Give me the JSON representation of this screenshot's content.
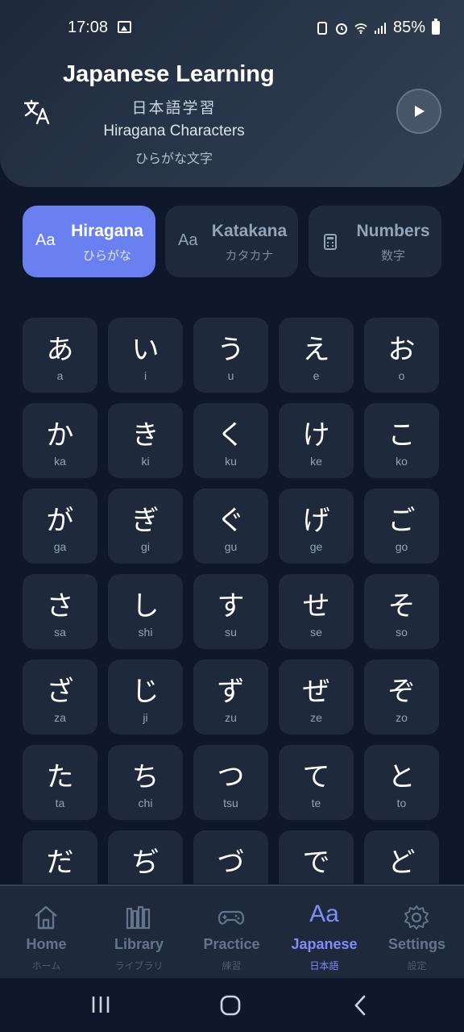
{
  "status": {
    "time": "17:08",
    "battery": "85%"
  },
  "header": {
    "title": "Japanese Learning",
    "subtitle_jp": "日本語学習",
    "subtitle": "Hiragana Characters",
    "subtitle_kana": "ひらがな文字"
  },
  "tabs": [
    {
      "icon": "Aa",
      "title": "Hiragana",
      "sub": "ひらがな",
      "active": true
    },
    {
      "icon": "Aa",
      "title": "Katakana",
      "sub": "カタカナ",
      "active": false
    },
    {
      "icon": "calculator-icon",
      "title": "Numbers",
      "sub": "数字",
      "active": false
    }
  ],
  "characters": [
    {
      "kana": "あ",
      "romaji": "a"
    },
    {
      "kana": "い",
      "romaji": "i"
    },
    {
      "kana": "う",
      "romaji": "u"
    },
    {
      "kana": "え",
      "romaji": "e"
    },
    {
      "kana": "お",
      "romaji": "o"
    },
    {
      "kana": "か",
      "romaji": "ka"
    },
    {
      "kana": "き",
      "romaji": "ki"
    },
    {
      "kana": "く",
      "romaji": "ku"
    },
    {
      "kana": "け",
      "romaji": "ke"
    },
    {
      "kana": "こ",
      "romaji": "ko"
    },
    {
      "kana": "が",
      "romaji": "ga"
    },
    {
      "kana": "ぎ",
      "romaji": "gi"
    },
    {
      "kana": "ぐ",
      "romaji": "gu"
    },
    {
      "kana": "げ",
      "romaji": "ge"
    },
    {
      "kana": "ご",
      "romaji": "go"
    },
    {
      "kana": "さ",
      "romaji": "sa"
    },
    {
      "kana": "し",
      "romaji": "shi"
    },
    {
      "kana": "す",
      "romaji": "su"
    },
    {
      "kana": "せ",
      "romaji": "se"
    },
    {
      "kana": "そ",
      "romaji": "so"
    },
    {
      "kana": "ざ",
      "romaji": "za"
    },
    {
      "kana": "じ",
      "romaji": "ji"
    },
    {
      "kana": "ず",
      "romaji": "zu"
    },
    {
      "kana": "ぜ",
      "romaji": "ze"
    },
    {
      "kana": "ぞ",
      "romaji": "zo"
    },
    {
      "kana": "た",
      "romaji": "ta"
    },
    {
      "kana": "ち",
      "romaji": "chi"
    },
    {
      "kana": "つ",
      "romaji": "tsu"
    },
    {
      "kana": "て",
      "romaji": "te"
    },
    {
      "kana": "と",
      "romaji": "to"
    },
    {
      "kana": "だ",
      "romaji": ""
    },
    {
      "kana": "ぢ",
      "romaji": ""
    },
    {
      "kana": "づ",
      "romaji": ""
    },
    {
      "kana": "で",
      "romaji": ""
    },
    {
      "kana": "ど",
      "romaji": ""
    }
  ],
  "nav": [
    {
      "label": "Home",
      "sub": "ホーム",
      "icon": "home-icon",
      "active": false
    },
    {
      "label": "Library",
      "sub": "ライブラリ",
      "icon": "library-icon",
      "active": false
    },
    {
      "label": "Practice",
      "sub": "練習",
      "icon": "gamepad-icon",
      "active": false
    },
    {
      "label": "Japanese",
      "sub": "日本語",
      "icon": "Aa",
      "active": true
    },
    {
      "label": "Settings",
      "sub": "設定",
      "icon": "gear-icon",
      "active": false
    }
  ],
  "colors": {
    "background": "#0f172a",
    "card": "#1e293b",
    "accent": "#6a7ff0",
    "nav_active": "#818cf8"
  }
}
